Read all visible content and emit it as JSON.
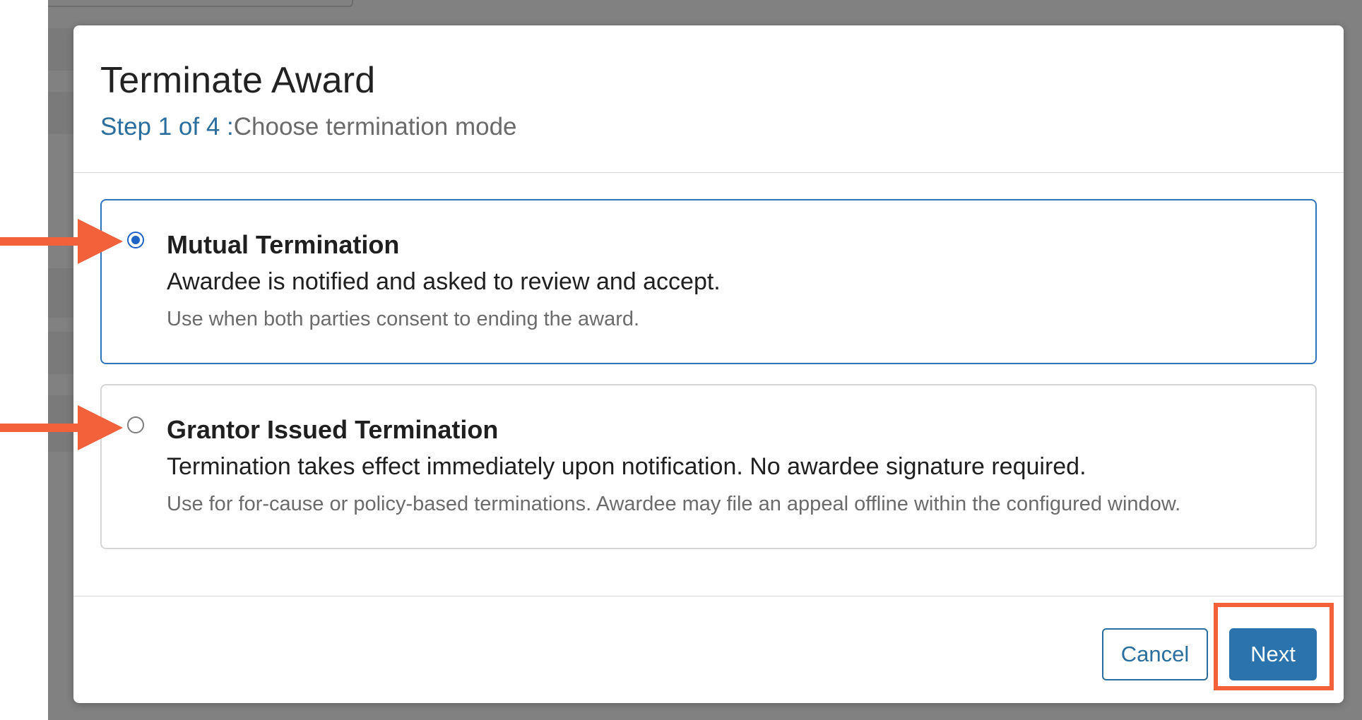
{
  "modal": {
    "title": "Terminate Award",
    "step_count": "Step 1 of 4 :",
    "step_label": "Choose termination mode"
  },
  "options": [
    {
      "title": "Mutual Termination",
      "description": "Awardee is notified and asked to review and accept.",
      "note": "Use when both parties consent to ending the award.",
      "selected": true
    },
    {
      "title": "Grantor Issued Termination",
      "description": "Termination takes effect immediately upon notification. No awardee signature required.",
      "note": "Use for for-cause or policy-based terminations. Awardee may file an appeal offline within the configured window.",
      "selected": false
    }
  ],
  "footer": {
    "cancel_label": "Cancel",
    "next_label": "Next"
  },
  "colors": {
    "accent": "#2b73ad",
    "link": "#2a6e9e",
    "radio_selected": "#1e63c4",
    "annotation": "#f26139",
    "backdrop": "#818181"
  }
}
